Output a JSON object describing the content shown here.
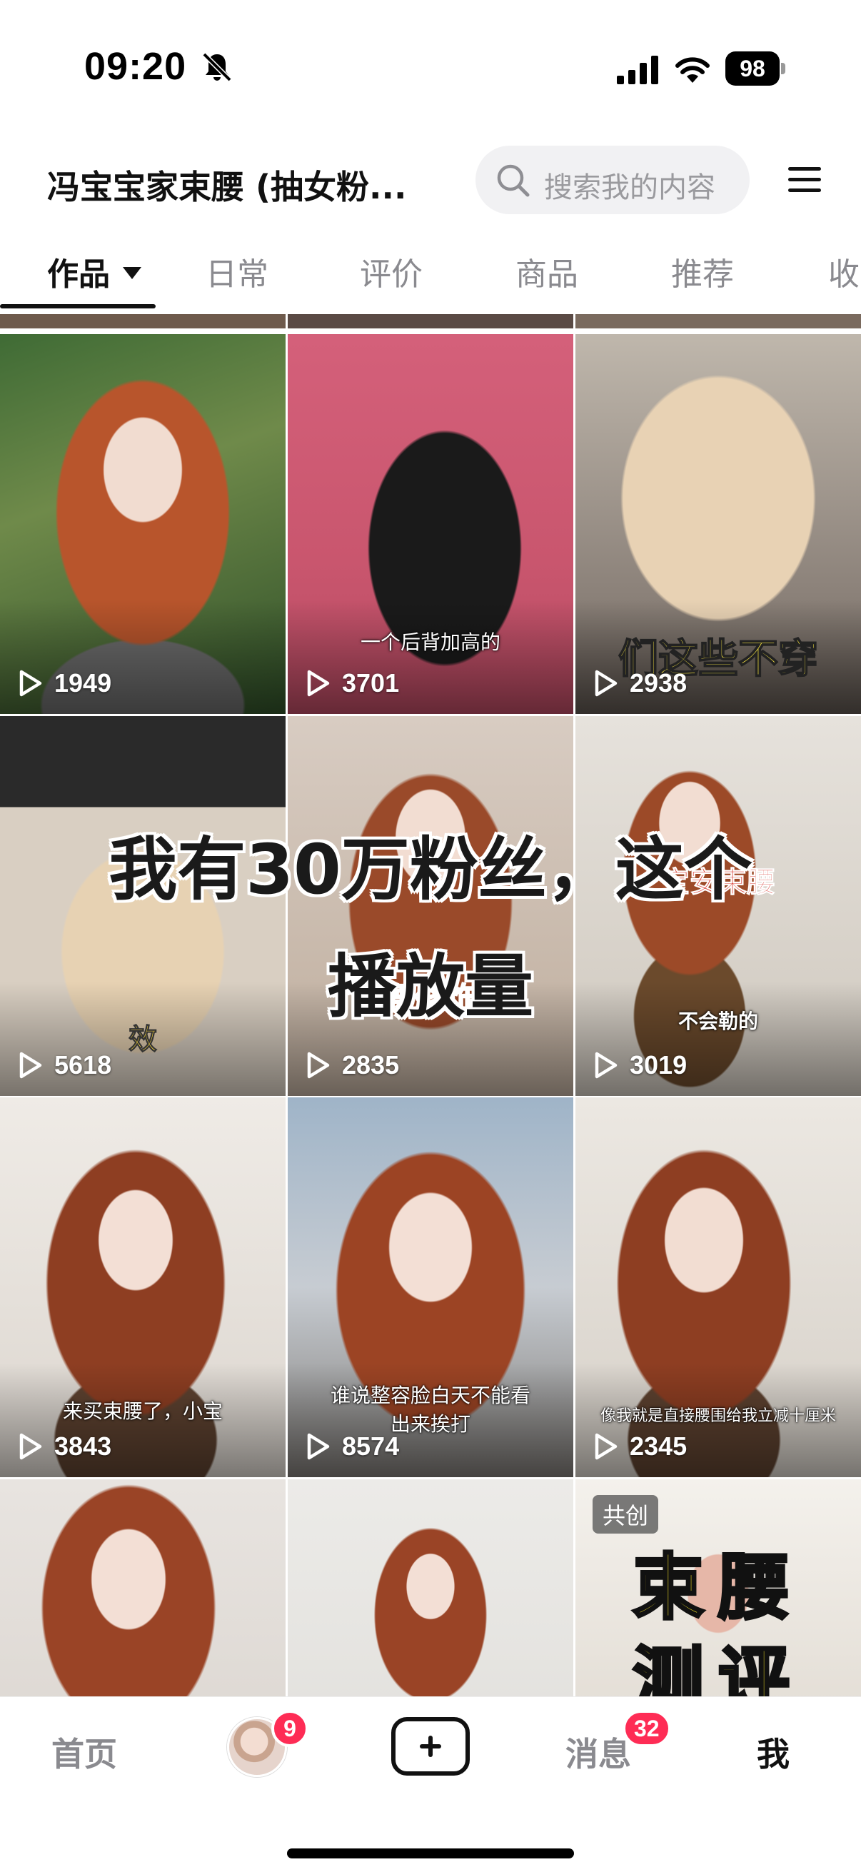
{
  "status_bar": {
    "time": "09:20",
    "battery": "98"
  },
  "header": {
    "title": "冯宝宝家束腰 (抽女粉...",
    "search_placeholder": "搜索我的内容"
  },
  "tabs": [
    {
      "label": "作品"
    },
    {
      "label": "日常"
    },
    {
      "label": "评价"
    },
    {
      "label": "商品"
    },
    {
      "label": "推荐"
    },
    {
      "label": "收"
    }
  ],
  "videos": [
    {
      "plays": "1949",
      "caption": ""
    },
    {
      "plays": "3701",
      "caption": "一个后背加高的"
    },
    {
      "plays": "2938",
      "caption": "们这些不穿"
    },
    {
      "plays": "5618",
      "caption": "效"
    },
    {
      "plays": "2835",
      "caption": "后腰修饰的"
    },
    {
      "plays": "3019",
      "caption": "不会勒的",
      "caption2": "宝安束腰"
    },
    {
      "plays": "3843",
      "caption": "来买束腰了，小宝"
    },
    {
      "plays": "8574",
      "caption": "谁说整容脸白天不能看",
      "caption2": "出来挨打"
    },
    {
      "plays": "2345",
      "caption": "像我就是直接腰围给我立减十厘米"
    },
    {
      "plays": "",
      "caption": ""
    },
    {
      "plays": "",
      "caption": ""
    },
    {
      "plays": "",
      "caption": "",
      "badge": "共创",
      "sticker_top": "束腰",
      "sticker_bottom": "测评"
    }
  ],
  "overlay": {
    "line1": "我有30万粉丝，这个",
    "line2": "播放量"
  },
  "bottom_nav": {
    "home": "首页",
    "friends_badge": "9",
    "messages": "消息",
    "messages_badge": "32",
    "me": "我"
  }
}
